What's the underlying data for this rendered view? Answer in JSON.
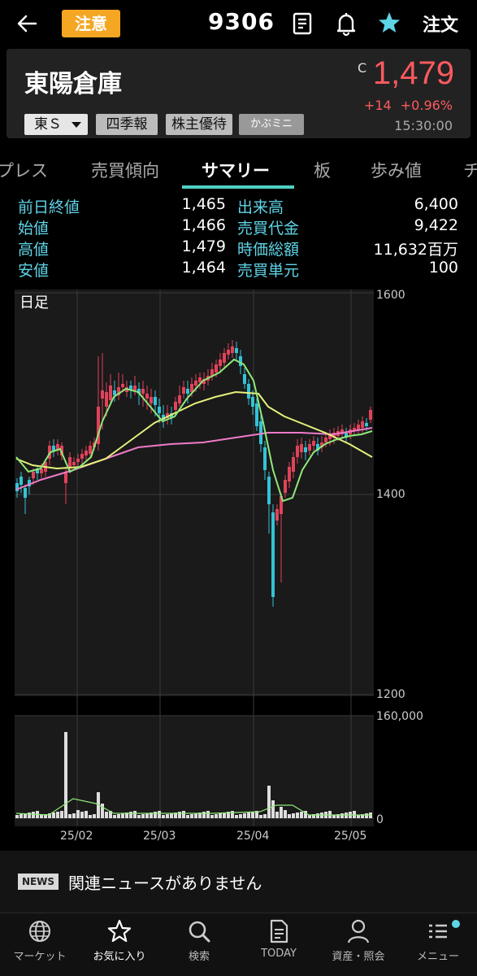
{
  "header": {
    "caution_label": "注意",
    "code": "9306",
    "order_label": "注文"
  },
  "stock": {
    "name": "東陽倉庫",
    "price_marker": "C",
    "price": "1,479",
    "change": "+14",
    "change_pct": "+0.96%",
    "time": "15:30:00",
    "market": "東Ｓ",
    "tags": [
      "四季報",
      "株主優待",
      "かぶミニ"
    ]
  },
  "tabs": [
    "プレス",
    "売買傾向",
    "サマリー",
    "板",
    "歩み値",
    "チ"
  ],
  "active_tab": "サマリー",
  "summary": {
    "left": [
      {
        "label": "前日終値",
        "value": "1,465"
      },
      {
        "label": "始値",
        "value": "1,466"
      },
      {
        "label": "高値",
        "value": "1,479"
      },
      {
        "label": "安値",
        "value": "1,464"
      }
    ],
    "right": [
      {
        "label": "出来高",
        "value": "6,400"
      },
      {
        "label": "売買代金",
        "value": "9,422"
      },
      {
        "label": "時価総額",
        "value": "11,632百万"
      },
      {
        "label": "売買単元",
        "value": "100"
      }
    ]
  },
  "chart_data": {
    "type": "candlestick",
    "title": "日足",
    "ylim": [
      1200,
      1600
    ],
    "yticks": [
      "1600",
      "1400",
      "1200"
    ],
    "volume_ticks": [
      "160,000",
      "0"
    ],
    "xticks": [
      "25/02",
      "25/03",
      "25/04",
      "25/05"
    ],
    "colors": {
      "up": "#e0435a",
      "down": "#33c3d6",
      "ma_short": "#8fe87a",
      "ma_mid": "#e6f07a",
      "ma_long": "#ef7bc9"
    }
  },
  "news": {
    "badge": "NEWS",
    "text": "関連ニュースがありません"
  },
  "nav": [
    {
      "label": "マーケット",
      "icon": "globe-icon"
    },
    {
      "label": "お気に入り",
      "icon": "star-icon"
    },
    {
      "label": "検索",
      "icon": "search-icon"
    },
    {
      "label": "TODAY",
      "icon": "document-icon"
    },
    {
      "label": "資産・照会",
      "icon": "person-icon"
    },
    {
      "label": "メニュー",
      "icon": "menu-icon"
    }
  ]
}
